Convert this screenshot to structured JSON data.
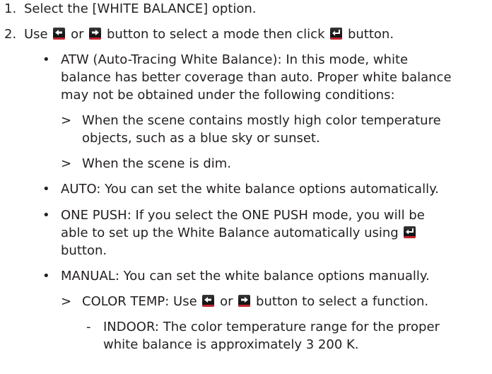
{
  "steps": [
    {
      "num": "1.",
      "text": "Select the [WHITE BALANCE] option."
    },
    {
      "num": "2.",
      "parts": [
        "Use",
        "or",
        "button to select a mode then click",
        "button."
      ]
    }
  ],
  "bullets": {
    "mark": "•",
    "atw": {
      "lines": [
        "ATW (Auto-Tracing White Balance): In this mode, white",
        "balance has better coverage than auto. Proper white balance",
        "may not be obtained under the following conditions:"
      ],
      "subs": [
        {
          "mark": ">",
          "lines": [
            "When the scene contains mostly high color temperature",
            "objects, such as a blue sky or sunset."
          ]
        },
        {
          "mark": ">",
          "lines": [
            "When the scene is dim."
          ]
        }
      ]
    },
    "auto": "AUTO: You can set the white balance options automatically.",
    "one_push": {
      "line1": "ONE PUSH: If you select the ONE PUSH mode, you will be",
      "line2": "able to set up the White Balance automatically using",
      "line3": "button."
    },
    "manual": {
      "text": "MANUAL: You can set the white balance options manually.",
      "sub": {
        "mark": ">",
        "parts": [
          "COLOR TEMP: Use",
          "or",
          "button to select a function."
        ],
        "item": {
          "mark": "-",
          "lines": [
            "INDOOR: The color temperature range for the proper",
            "white balance is approximately 3 200 K."
          ]
        }
      }
    }
  },
  "icons": {
    "left": "left-arrow-icon",
    "right": "right-arrow-icon",
    "enter": "enter-icon",
    "accent": "#c3262e"
  }
}
